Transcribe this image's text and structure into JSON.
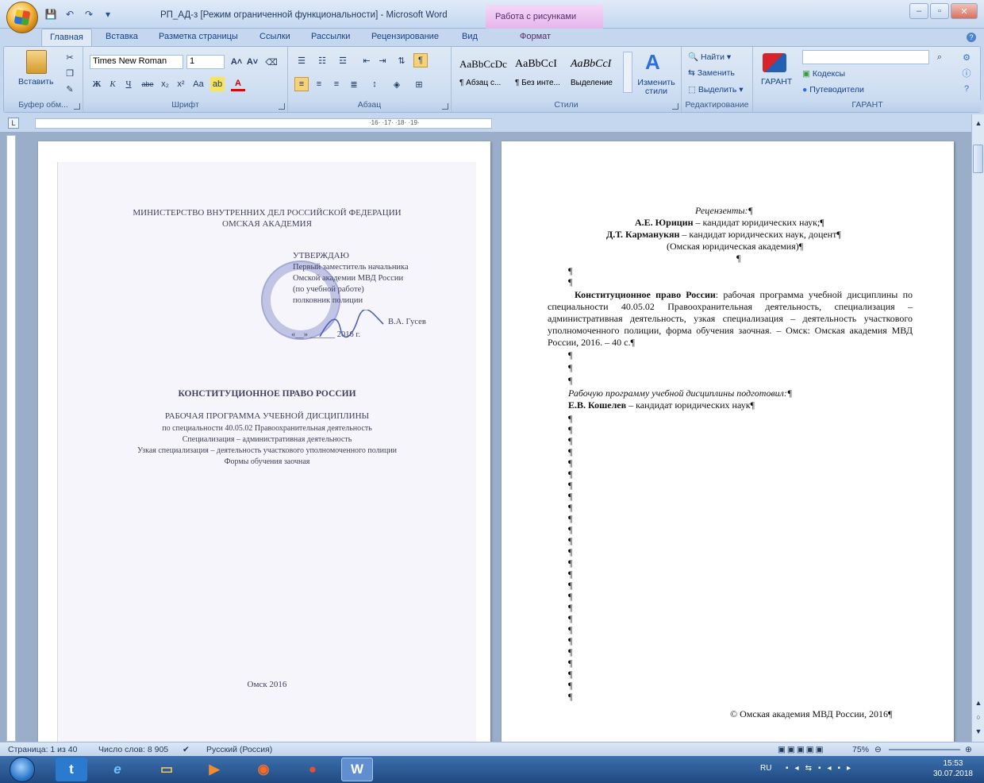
{
  "titlebar": {
    "doc_title": "РП_АД-з [Режим ограниченной функциональности] - Microsoft Word",
    "context_tab": "Работа с рисунками"
  },
  "tabs": [
    "Главная",
    "Вставка",
    "Разметка страницы",
    "Ссылки",
    "Рассылки",
    "Рецензирование",
    "Вид",
    "Формат"
  ],
  "ribbon": {
    "clipboard": {
      "paste": "Вставить",
      "label": "Буфер обм..."
    },
    "font": {
      "name": "Times New Roman",
      "size": "1",
      "label": "Шрифт"
    },
    "paragraph": {
      "label": "Абзац"
    },
    "styles": {
      "items": [
        {
          "sample": "AaBbCcDc",
          "name": "¶ Абзац с..."
        },
        {
          "sample": "AaBbCcI",
          "name": "¶ Без инте..."
        },
        {
          "sample": "AaBbCcI",
          "name": "Выделение"
        }
      ],
      "change": "Изменить стили",
      "label": "Стили"
    },
    "editing": {
      "find": "Найти",
      "replace": "Заменить",
      "select": "Выделить",
      "label": "Редактирование"
    },
    "garant": {
      "button": "ГАРАНТ",
      "kodeksy": "Кодексы",
      "putevoditeli": "Путеводители",
      "label": "ГАРАНТ"
    }
  },
  "ruler": {
    "marks": "·16· ·17· ·18· ·19·"
  },
  "page1": {
    "ministry": "МИНИСТЕРСТВО ВНУТРЕННИХ ДЕЛ РОССИЙСКОЙ ФЕДЕРАЦИИ",
    "academy": "ОМСКАЯ АКАДЕМИЯ",
    "approve": "УТВЕРЖДАЮ",
    "approve_2": "Первый заместитель начальника",
    "approve_3": "Омской академии МВД России",
    "approve_4": "(по учебной работе)",
    "approve_5": "полковник полиции",
    "approve_signer": "В.А. Гусев",
    "approve_date": "«__» ______ 2016 г.",
    "title": "КОНСТИТУЦИОННОЕ ПРАВО РОССИИ",
    "subtitle": "РАБОЧАЯ ПРОГРАММА УЧЕБНОЙ ДИСЦИПЛИНЫ",
    "line1": "по специальности 40.05.02 Правоохранительная деятельность",
    "line2": "Специализация – административная деятельность",
    "line3": "Узкая специализация – деятельность участкового уполномоченного полиции",
    "line4": "Формы обучения заочная",
    "city_year": "Омск 2016"
  },
  "page2": {
    "reviewers": "Рецензенты:¶",
    "reviewer1_name": "А.Е. Юрицин",
    "reviewer1_rest": "– кандидат юридических наук;¶",
    "reviewer2_name": "Д.Т. Карманукян",
    "reviewer2_rest": "– кандидат юридических наук, доцент¶",
    "reviewer2_org": "(Омская юридическая академия)¶",
    "annot_bold": "Конституционное право России",
    "annot_rest": ": рабочая программа учебной дисциплины по специальности 40.05.02 Правоохранительная деятельность, специализация – административная деятельность, узкая специализация – деятельность участкового уполномоченного полиции, форма обучения заочная. – Омск: Омская академия МВД России, 2016. – 40 с.¶",
    "prepared": "Рабочую программу учебной дисциплины подготовил:¶",
    "author_name": "Е.В. Кошелев",
    "author_rest": "– кандидат юридических наук¶",
    "copyright": "© Омская академия МВД России, 2016¶",
    "pilcrow": "¶"
  },
  "status": {
    "page": "Страница: 1 из 40",
    "words": "Число слов: 8 905",
    "language": "Русский (Россия)",
    "zoom": "75%"
  },
  "taskbar": {
    "lang": "RU",
    "time": "15:53",
    "date": "30.07.2018"
  }
}
